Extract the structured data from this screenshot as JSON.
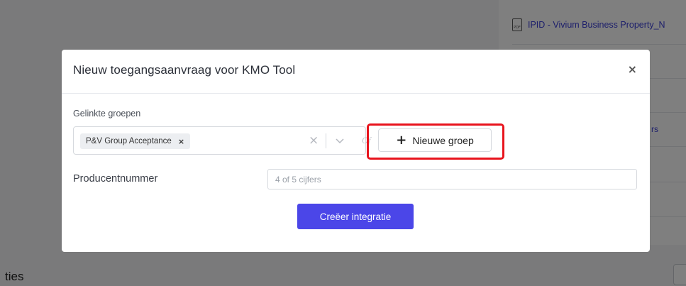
{
  "background": {
    "file_link_text": "IPID - Vivium Business Property_N",
    "file_icon": "pdf-file-icon",
    "partial_link_text": "rs",
    "section_heading_partial": "ties"
  },
  "modal": {
    "title": "Nieuw toegangsaanvraag voor KMO Tool",
    "close_label": "×",
    "linked_groups": {
      "label": "Gelinkte groepen",
      "selected": [
        {
          "label": "P&V Group Acceptance",
          "remove_label": "×"
        }
      ],
      "clear_label": "×"
    },
    "or_label": "Of",
    "new_group_button": {
      "icon": "+",
      "label": "Nieuwe groep"
    },
    "producer_number": {
      "label": "Producentnummer",
      "value": "",
      "placeholder": "4 of 5 cijfers"
    },
    "submit_label": "Creëer integratie"
  },
  "colors": {
    "accent": "#4b46e8",
    "highlight": "#e8141d",
    "link": "#3b3fd6"
  }
}
